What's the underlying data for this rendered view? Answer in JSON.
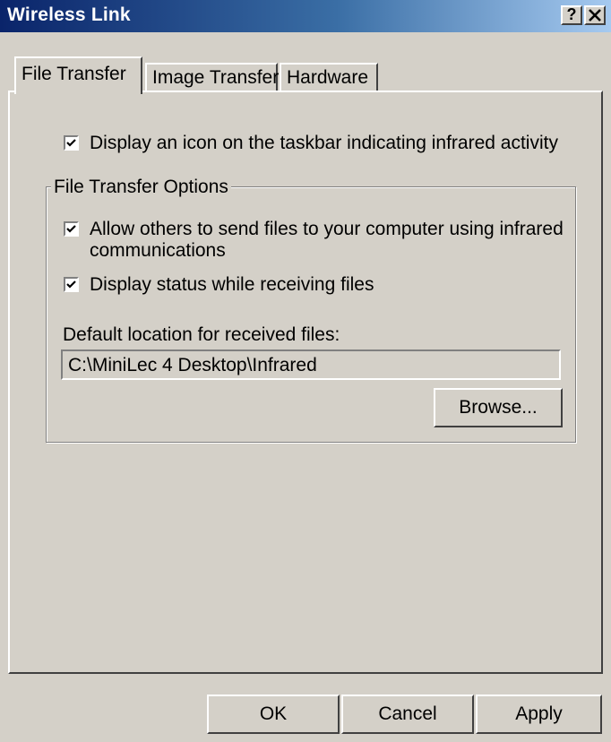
{
  "window": {
    "title": "Wireless Link",
    "help_button": "?",
    "close_button": "×"
  },
  "tabs": [
    "File Transfer",
    "Image Transfer",
    "Hardware"
  ],
  "options": {
    "taskbar_icon": {
      "label": "Display an icon on the taskbar indicating infrared activity",
      "checked": true
    }
  },
  "group": {
    "title": "File Transfer Options",
    "allow_send_line1": "Allow others to send files to your computer using infrared",
    "allow_send_line2": "communications",
    "allow_send_checked": true,
    "display_status": "Display status while receiving files",
    "display_status_checked": true,
    "location_label": "Default location for received files:",
    "location_value": "C:\\MiniLec 4 Desktop\\Infrared",
    "browse_label": "Browse..."
  },
  "footer": {
    "ok_label": "OK",
    "cancel_label": "Cancel",
    "apply_label": "Apply"
  },
  "colors": {
    "face": "#d4d0c8",
    "title_start": "#0a246a",
    "title_end": "#a6caf0"
  }
}
